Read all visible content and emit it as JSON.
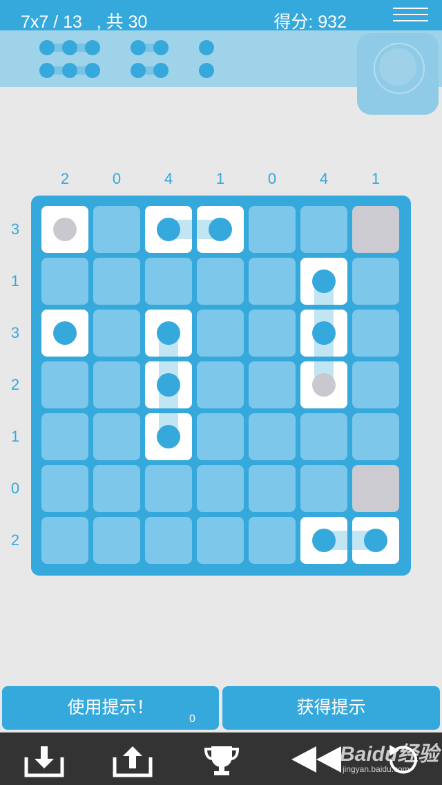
{
  "header": {
    "level": "7x7 / 13   , 共 30",
    "score": "得分: 932"
  },
  "column_clues": [
    "2",
    "0",
    "4",
    "1",
    "0",
    "4",
    "1"
  ],
  "row_clues": [
    "3",
    "1",
    "3",
    "2",
    "1",
    "0",
    "2"
  ],
  "board": {
    "size": 7,
    "cells": [
      [
        "ship-gray",
        "empty",
        "ship",
        "ship",
        "empty",
        "empty",
        "water"
      ],
      [
        "empty",
        "empty",
        "empty",
        "empty",
        "empty",
        "ship",
        "empty"
      ],
      [
        "ship",
        "empty",
        "ship",
        "empty",
        "empty",
        "ship",
        "empty"
      ],
      [
        "empty",
        "empty",
        "ship",
        "empty",
        "empty",
        "ship-gray",
        "empty"
      ],
      [
        "empty",
        "empty",
        "ship",
        "empty",
        "empty",
        "empty",
        "empty"
      ],
      [
        "empty",
        "empty",
        "empty",
        "empty",
        "empty",
        "empty",
        "water"
      ],
      [
        "empty",
        "empty",
        "empty",
        "empty",
        "empty",
        "ship",
        "ship"
      ]
    ]
  },
  "buttons": {
    "use_hint": "使用提示！",
    "hint_count": "0",
    "get_hint": "获得提示"
  },
  "toolbar_icons": [
    "download-icon",
    "upload-icon",
    "trophy-icon",
    "rewind-icon",
    "undo-icon"
  ],
  "watermark": {
    "text": "Baidu经验",
    "sub": "jingyan.baidu.com"
  },
  "colors": {
    "accent": "#35a8dc",
    "cell": "#7cc7ea",
    "water": "#cbcbd1",
    "toolbar": "#333333"
  }
}
